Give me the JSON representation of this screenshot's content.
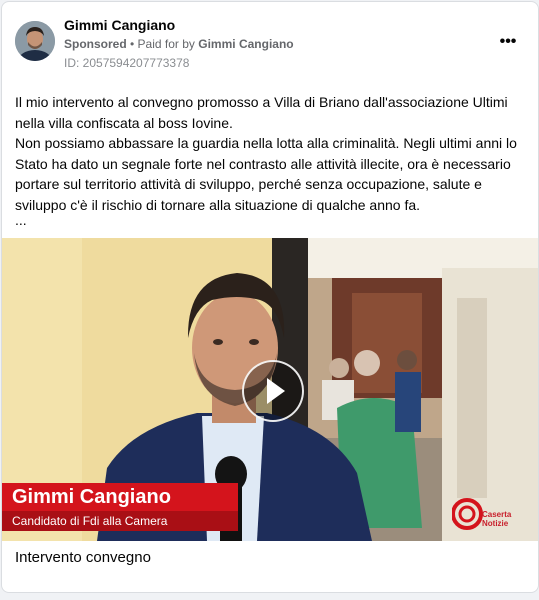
{
  "post": {
    "author": "Gimmi Cangiano",
    "sponsored": "Sponsored",
    "paid_for_prefix": "• Paid for by",
    "paid_for_name": "Gimmi Cangiano",
    "ad_id": "ID: 2057594207773378",
    "paragraph1": "Il mio intervento al convegno promosso a Villa di Briano dall'associazione Ultimi nella villa confiscata al boss Iovine.",
    "paragraph2": "Non possiamo abbassare la guardia nella lotta alla criminalità. Negli ultimi anni lo Stato ha dato un segnale forte nel contrasto alle attività illecite, ora è necessario portare sul territorio attività di sviluppo, perché senza occupazione, salute e sviluppo c'è il rischio di tornare alla situazione di qualche anno fa.",
    "ellipsis": "...",
    "more_icon": "more-options-icon",
    "more_glyph": "•••"
  },
  "video": {
    "lower_third_name": "Gimmi Cangiano",
    "lower_third_role": "Candidato di Fdi alla Camera",
    "play_icon": "play-icon",
    "logo_line1": "Caserta",
    "logo_line2": "Notizie"
  },
  "caption": "Intervento convegno",
  "colors": {
    "lower_third_red": "#d4141c",
    "meta_gray": "#65676b"
  }
}
